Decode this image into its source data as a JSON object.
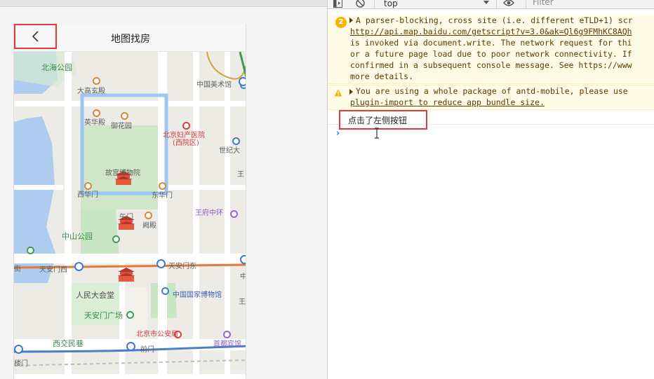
{
  "app": {
    "nav_title": "地图找房",
    "back_icon": "chevron-left-icon"
  },
  "map": {
    "labels": {
      "beihai": "北海公园",
      "dagaoxuandian": "大高玄殿",
      "artmuseum": "中国美术馆",
      "yingongdian": "英华殿",
      "yuhuayuan": "御花园",
      "fuchan": "北京妇产医院",
      "fuchan_sub": "(西院区)",
      "shiji": "世纪大",
      "palace_museum": "故宫博物院",
      "wang1": "王",
      "xihuamen": "西华门",
      "donghuamen": "东华门",
      "wumen": "午门",
      "quedian": "阙殿",
      "wangfujing": "王府中环",
      "zhongshan": "中山公园",
      "tiananmenxi": "天安门西",
      "tiananmendong": "天安门东",
      "zhong": "中",
      "renmin": "人民大会堂",
      "national_museum": "中国国家博物馆",
      "wang2": "王",
      "square": "天安门广场",
      "police": "北京市公安局",
      "xijiao": "西交民巷",
      "qianmen": "前门",
      "shoudu": "首都宾馆",
      "jie": "街",
      "lou": "楼门"
    },
    "colors": {
      "road": "#ffffff",
      "water": "#aecbf0",
      "park": "#c8e5c4",
      "palace_border": "#9cc7f2",
      "subway_orange": "#e4793c",
      "subway_blue": "#4a7fc8"
    }
  },
  "console": {
    "toolbar": {
      "context": "top",
      "filter_placeholder": "Filter",
      "icons": [
        "sidebar-icon",
        "clear-icon",
        "eye-icon"
      ]
    },
    "messages": [
      {
        "type": "warning",
        "count": "2",
        "lines": [
          "A parser-blocking, cross site (i.e. different eTLD+1) scr",
          "http://api.map.baidu.com/getscript?v=3.0&ak=Ql6g9FMhKC8AQh",
          "is invoked via document.write. The network request for thi",
          "or a future page load due to poor network connectivity. If",
          "confirmed in a subsequent console message. See https://www",
          "more details."
        ]
      },
      {
        "type": "warning",
        "lines": [
          "You are using a whole package of antd-mobile, please use",
          "plugin-import to reduce app bundle size."
        ]
      }
    ],
    "log": "点击了左侧按钮",
    "prompt": "›"
  }
}
